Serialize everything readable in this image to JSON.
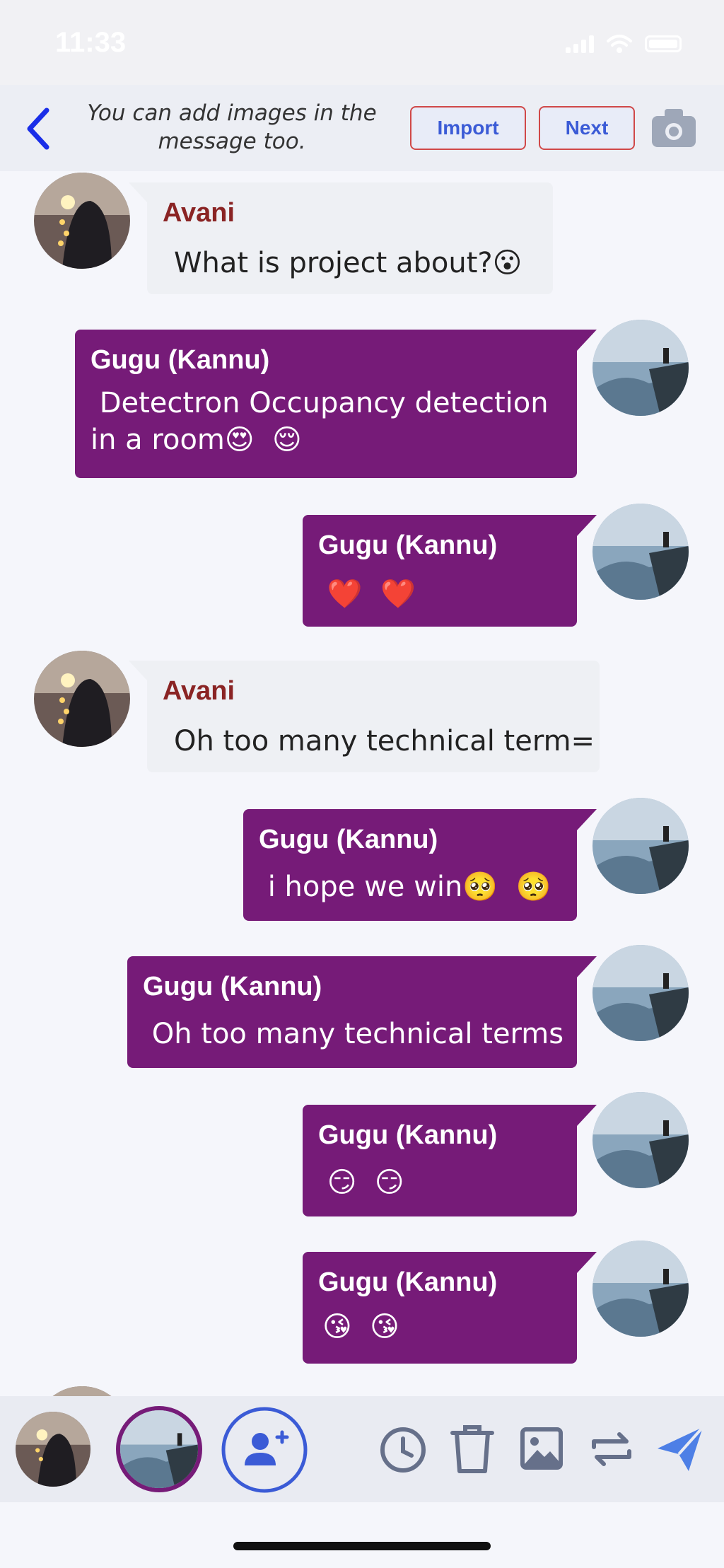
{
  "status_bar": {
    "time": "11:33"
  },
  "header": {
    "hint": "You can add images in the message too.",
    "import_label": "Import",
    "next_label": "Next"
  },
  "messages": [
    {
      "side": "left",
      "name": "Avani",
      "text": "What is project about?😮"
    },
    {
      "side": "right",
      "name": "Gugu (Kannu)",
      "text": " Detectron Occupancy detection\nin a room😍  😌"
    },
    {
      "side": "right",
      "name": "Gugu (Kannu)",
      "text": " ❤️  ❤️"
    },
    {
      "side": "left",
      "name": "Avani",
      "text": "Oh too many technical term="
    },
    {
      "side": "right",
      "name": "Gugu (Kannu)",
      "text": " i hope we win🥺  🥺"
    },
    {
      "side": "right",
      "name": "Gugu (Kannu)",
      "text": " Oh too many technical terms"
    },
    {
      "side": "right",
      "name": "Gugu (Kannu)",
      "text": " 😏  😏"
    },
    {
      "side": "right",
      "name": "Gugu (Kannu)",
      "text": "😘  😘"
    }
  ],
  "icons": {
    "back": "chevron-left-icon",
    "camera": "camera-icon",
    "add_user": "user-plus-icon",
    "clock": "clock-icon",
    "trash": "trash-icon",
    "image": "image-icon",
    "swap": "repeat-icon",
    "send": "send-icon"
  },
  "colors": {
    "sent_bubble": "#761b78",
    "received_bubble": "#eef0f4",
    "received_name": "#8a2424",
    "accent_blue": "#3b5bd6",
    "button_border": "#d04848"
  }
}
